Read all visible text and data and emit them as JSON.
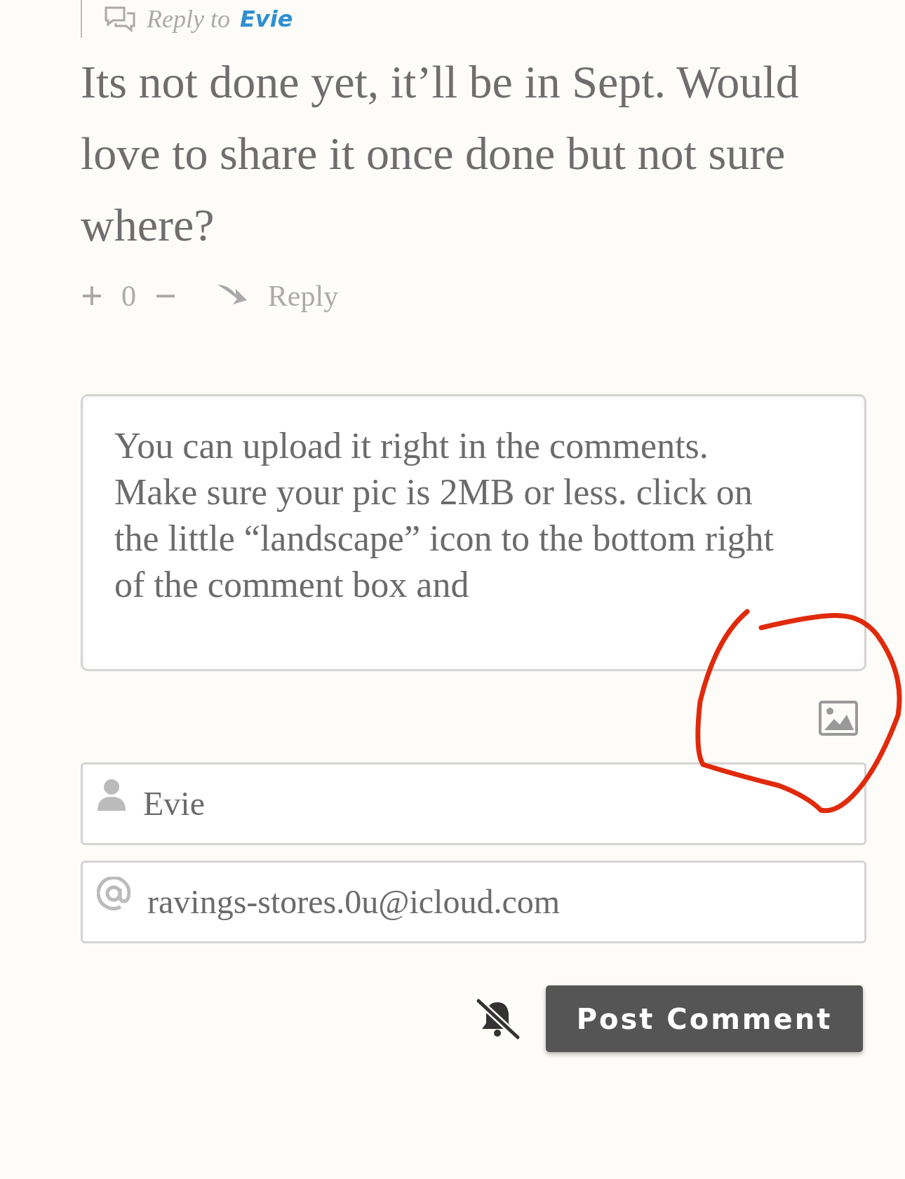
{
  "reply_to": {
    "label": "Reply to",
    "name": "Evie"
  },
  "comment": {
    "text": "Its not done yet, it’ll be in Sept. Would love to share it once done but not sure where?"
  },
  "votes": {
    "plus": "+",
    "count": "0",
    "minus": "−",
    "reply": "Reply"
  },
  "form": {
    "message": "You can upload it right in the comments. Make sure your pic is 2MB or less. click on the little “landscape” icon to the bottom right of the comment box and",
    "name": "Evie",
    "email": "ravings-stores.0u@icloud.com",
    "notify": false,
    "submit": "Post Comment"
  }
}
